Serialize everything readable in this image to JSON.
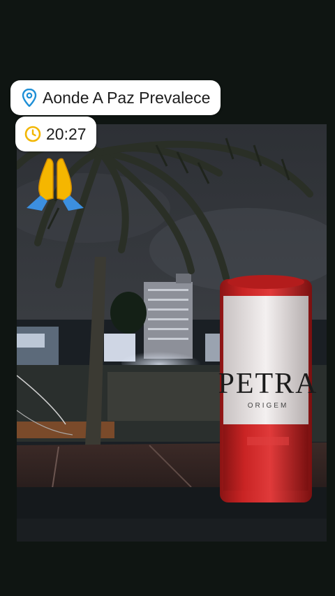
{
  "story": {
    "location_sticker": {
      "icon": "location-pin-icon",
      "text": "Aonde A Paz Prevalece"
    },
    "time_sticker": {
      "icon": "clock-icon",
      "text": "20:27"
    },
    "emoji_sticker": {
      "icon": "folded-hands-emoji"
    }
  },
  "photo": {
    "can_brand": "PETRA",
    "can_sub": "ORIGEM"
  },
  "colors": {
    "background": "#0f1512",
    "sticker_bg": "#ffffff",
    "pin_blue": "#1e8fd6",
    "clock_yellow": "#f2b600"
  }
}
